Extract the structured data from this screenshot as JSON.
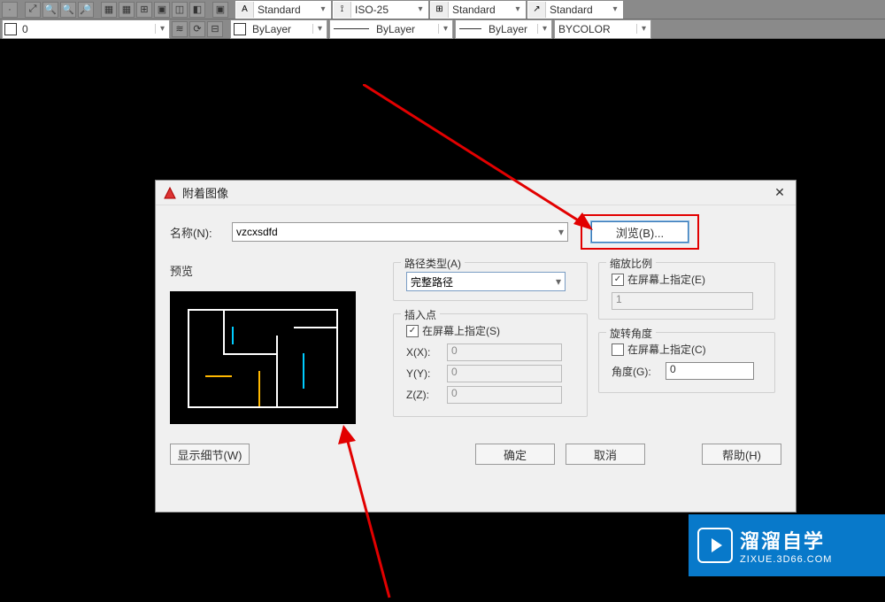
{
  "toolbar": {
    "styles": [
      {
        "label": "Standard"
      },
      {
        "label": "ISO-25"
      },
      {
        "label": "Standard"
      },
      {
        "label": "Standard"
      }
    ],
    "layer_name": "0",
    "props": {
      "bylayer1": "ByLayer",
      "bylayer2": "ByLayer",
      "bylayer3": "ByLayer",
      "bycolor": "BYCOLOR"
    }
  },
  "dialog": {
    "title": "附着图像",
    "name_label": "名称(N):",
    "name_value": "vzcxsdfd",
    "browse": "浏览(B)...",
    "preview_label": "预览",
    "path_group": "路径类型(A)",
    "path_value": "完整路径",
    "insert_group": "插入点",
    "specify_screen_s": "在屏幕上指定(S)",
    "x_label": "X(X):",
    "y_label": "Y(Y):",
    "z_label": "Z(Z):",
    "x_val": "0",
    "y_val": "0",
    "z_val": "0",
    "scale_group": "缩放比例",
    "specify_screen_e": "在屏幕上指定(E)",
    "scale_val": "1",
    "rotate_group": "旋转角度",
    "specify_screen_c": "在屏幕上指定(C)",
    "angle_label": "角度(G):",
    "angle_val": "0",
    "show_details": "显示细节(W)",
    "ok": "确定",
    "cancel": "取消",
    "help": "帮助(H)"
  },
  "watermark": {
    "title": "溜溜自学",
    "url": "ZIXUE.3D66.COM"
  }
}
